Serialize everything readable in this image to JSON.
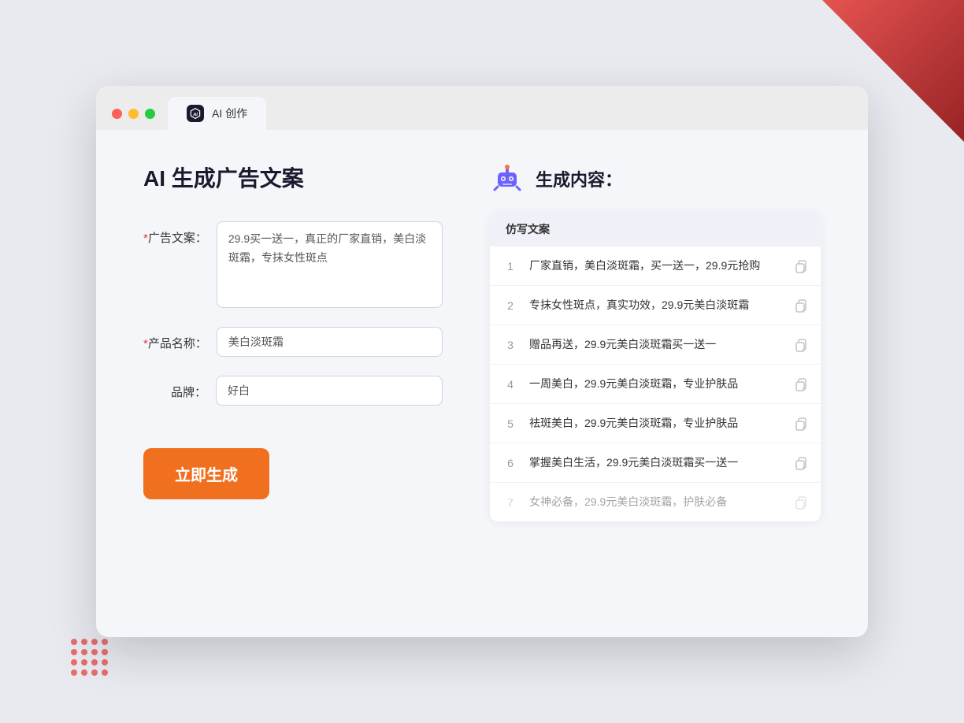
{
  "decorations": {
    "top_right_color": "#cc0000",
    "dots_color": "#e53935"
  },
  "browser": {
    "tab_label": "AI 创作",
    "ai_icon_text": "AI"
  },
  "left_panel": {
    "title": "AI 生成广告文案",
    "form": {
      "ad_copy_label": "广告文案：",
      "ad_copy_required": "*",
      "ad_copy_value": "29.9买一送一，真正的厂家直销，美白淡斑霜，专抹女性斑点",
      "product_name_label": "产品名称：",
      "product_name_required": "*",
      "product_name_value": "美白淡斑霜",
      "brand_label": "品牌：",
      "brand_value": "好白"
    },
    "generate_button": "立即生成"
  },
  "right_panel": {
    "header_title": "生成内容：",
    "table_header": "仿写文案",
    "results": [
      {
        "num": "1",
        "text": "厂家直销，美白淡斑霜，买一送一，29.9元抢购",
        "dimmed": false
      },
      {
        "num": "2",
        "text": "专抹女性斑点，真实功效，29.9元美白淡斑霜",
        "dimmed": false
      },
      {
        "num": "3",
        "text": "赠品再送，29.9元美白淡斑霜买一送一",
        "dimmed": false
      },
      {
        "num": "4",
        "text": "一周美白，29.9元美白淡斑霜，专业护肤品",
        "dimmed": false
      },
      {
        "num": "5",
        "text": "祛斑美白，29.9元美白淡斑霜，专业护肤品",
        "dimmed": false
      },
      {
        "num": "6",
        "text": "掌握美白生活，29.9元美白淡斑霜买一送一",
        "dimmed": false
      },
      {
        "num": "7",
        "text": "女神必备，29.9元美白淡斑霜，护肤必备",
        "dimmed": true
      }
    ]
  }
}
